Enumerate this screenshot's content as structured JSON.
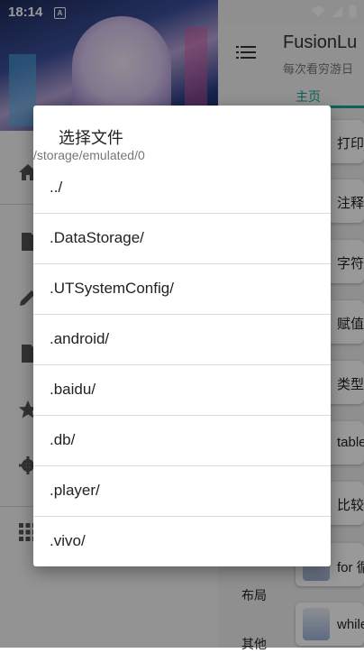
{
  "status_bar": {
    "time": "18:14",
    "notification_badge": "A",
    "icons": [
      "wifi-icon",
      "signal-icon",
      "battery-icon"
    ]
  },
  "drawer": {
    "menu_icons": [
      "home-icon",
      "file-icon",
      "edit-icon",
      "document-icon",
      "star-icon",
      "settings-icon",
      "grid-icon"
    ]
  },
  "app": {
    "title": "FusionLu",
    "subtitle": "每次看穷游日",
    "tab_label": "主页",
    "accent_color": "#16a394",
    "cards": [
      "打印",
      "注释",
      "字符",
      "赋值",
      "类型",
      "table",
      "比较",
      "for 循",
      "while"
    ],
    "bottom_items": [
      "布局",
      "其他"
    ]
  },
  "dialog": {
    "title": "选择文件",
    "path": "/storage/emulated/0",
    "entries": [
      "../",
      ".DataStorage/",
      ".UTSystemConfig/",
      ".android/",
      ".baidu/",
      ".db/",
      ".player/",
      ".vivo/"
    ]
  }
}
